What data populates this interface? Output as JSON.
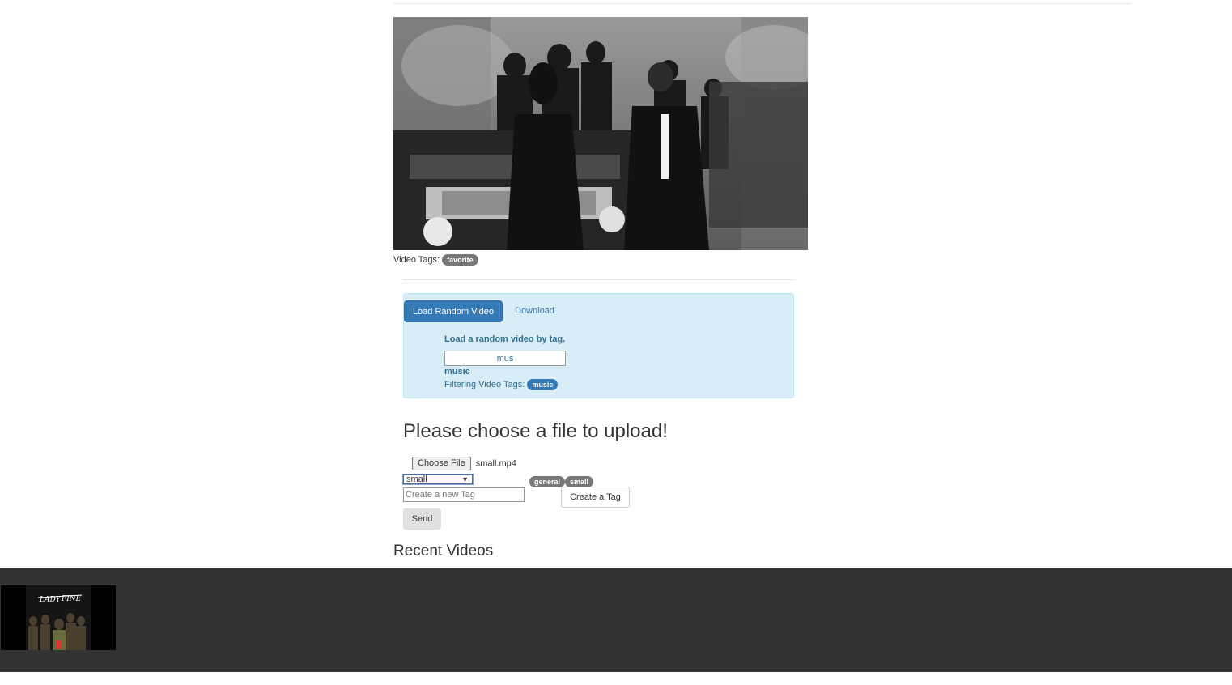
{
  "video": {
    "player_label": "video-player",
    "tags_label": "Video Tags:",
    "tags": [
      "favorite"
    ]
  },
  "random_panel": {
    "tabs": [
      {
        "label": "Load Random Video",
        "active": true
      },
      {
        "label": "Download",
        "active": false
      }
    ],
    "heading": "Load a random video by tag.",
    "search_value": "mus",
    "suggestion": "music",
    "filter_label": "Filtering Video Tags:",
    "filter_tags": [
      "music"
    ]
  },
  "upload": {
    "title": "Please choose a file to upload!",
    "choose_file_label": "Choose File",
    "file_name": "small.mp4",
    "selected_tag": "small",
    "assigned_tags": [
      "general",
      "small"
    ],
    "new_tag_placeholder": "Create a new Tag",
    "create_tag_label": "Create a Tag",
    "send_label": "Send"
  },
  "recent": {
    "title": "Recent Videos"
  },
  "colors": {
    "primary": "#337ab7",
    "panel_bg": "#d9edf7",
    "badge_gray": "#777777",
    "recent_bg": "#333333"
  }
}
